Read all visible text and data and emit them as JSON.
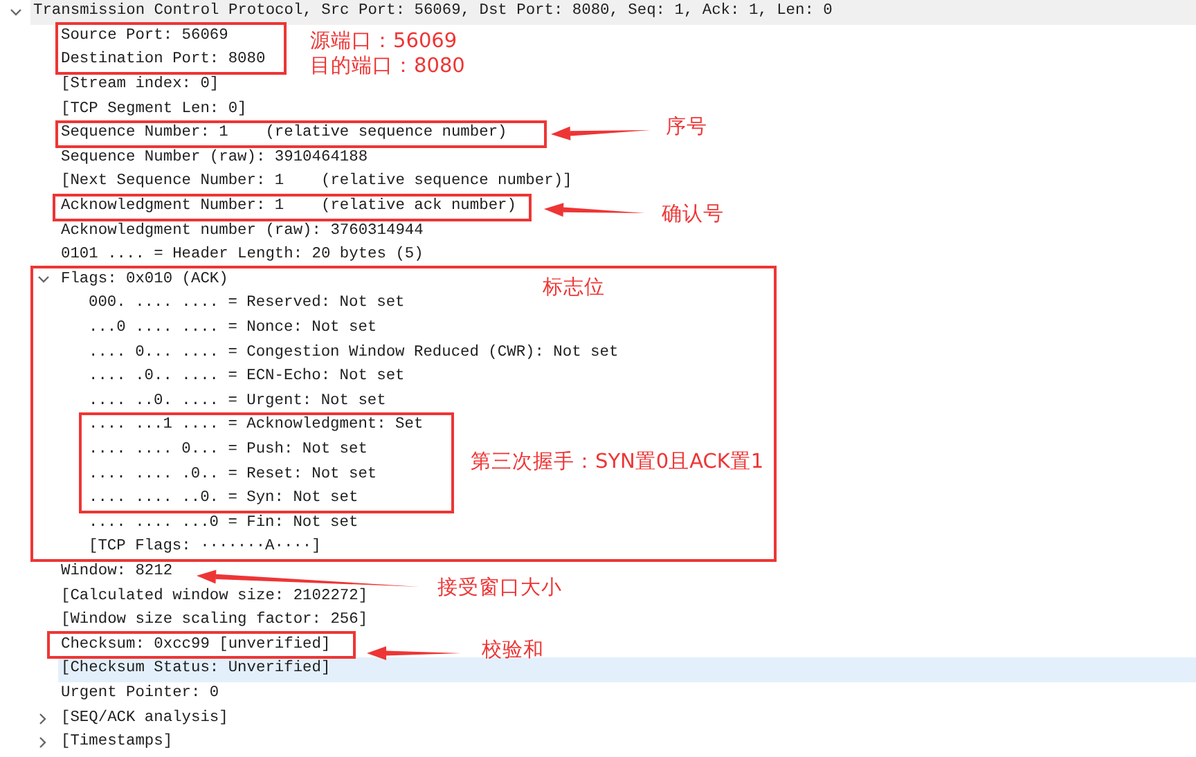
{
  "tree": [
    {
      "label": "Transmission Control Protocol, Src Port: 56069, Dst Port: 8080, Seq: 1, Ack: 1, Len: 0",
      "expanded": true,
      "selected": false,
      "children": [
        {
          "label": "Source Port: 56069",
          "selected": false
        },
        {
          "label": "Destination Port: 8080",
          "selected": false
        },
        {
          "label": "[Stream index: 0]",
          "selected": false
        },
        {
          "label": "[TCP Segment Len: 0]",
          "selected": false
        },
        {
          "label": "Sequence Number: 1    (relative sequence number)",
          "selected": false
        },
        {
          "label": "Sequence Number (raw): 3910464188",
          "selected": false
        },
        {
          "label": "[Next Sequence Number: 1    (relative sequence number)]",
          "selected": false
        },
        {
          "label": "Acknowledgment Number: 1    (relative ack number)",
          "selected": false
        },
        {
          "label": "Acknowledgment number (raw): 3760314944",
          "selected": false
        },
        {
          "label": "0101 .... = Header Length: 20 bytes (5)",
          "selected": false
        },
        {
          "label": "Flags: 0x010 (ACK)",
          "expanded": true,
          "selected": false,
          "children": [
            {
              "label": "000. .... .... = Reserved: Not set",
              "selected": false
            },
            {
              "label": "...0 .... .... = Nonce: Not set",
              "selected": false
            },
            {
              "label": ".... 0... .... = Congestion Window Reduced (CWR): Not set",
              "selected": false
            },
            {
              "label": ".... .0.. .... = ECN-Echo: Not set",
              "selected": false
            },
            {
              "label": ".... ..0. .... = Urgent: Not set",
              "selected": false
            },
            {
              "label": ".... ...1 .... = Acknowledgment: Set",
              "selected": false
            },
            {
              "label": ".... .... 0... = Push: Not set",
              "selected": false
            },
            {
              "label": ".... .... .0.. = Reset: Not set",
              "selected": false
            },
            {
              "label": ".... .... ..0. = Syn: Not set",
              "selected": false
            },
            {
              "label": ".... .... ...0 = Fin: Not set",
              "selected": false
            },
            {
              "label": "[TCP Flags: ·······A····]",
              "selected": false
            }
          ]
        },
        {
          "label": "Window: 8212",
          "selected": false
        },
        {
          "label": "[Calculated window size: 2102272]",
          "selected": false
        },
        {
          "label": "[Window size scaling factor: 256]",
          "selected": false
        },
        {
          "label": "Checksum: 0xcc99 [unverified]",
          "selected": false
        },
        {
          "label": "[Checksum Status: Unverified]",
          "selected": true
        },
        {
          "label": "Urgent Pointer: 0",
          "selected": false
        },
        {
          "label": "[SEQ/ACK analysis]",
          "expanded": false,
          "selected": false
        },
        {
          "label": "[Timestamps]",
          "expanded": false,
          "selected": false
        }
      ]
    }
  ],
  "annotations": [
    {
      "text": "源端口：56069"
    },
    {
      "text": "目的端口：8080"
    },
    {
      "text": "序号"
    },
    {
      "text": "确认号"
    },
    {
      "text": "标志位"
    },
    {
      "text": "第三次握手：SYN置0且ACK置1"
    },
    {
      "text": "接受窗口大小"
    },
    {
      "text": "校验和"
    }
  ]
}
